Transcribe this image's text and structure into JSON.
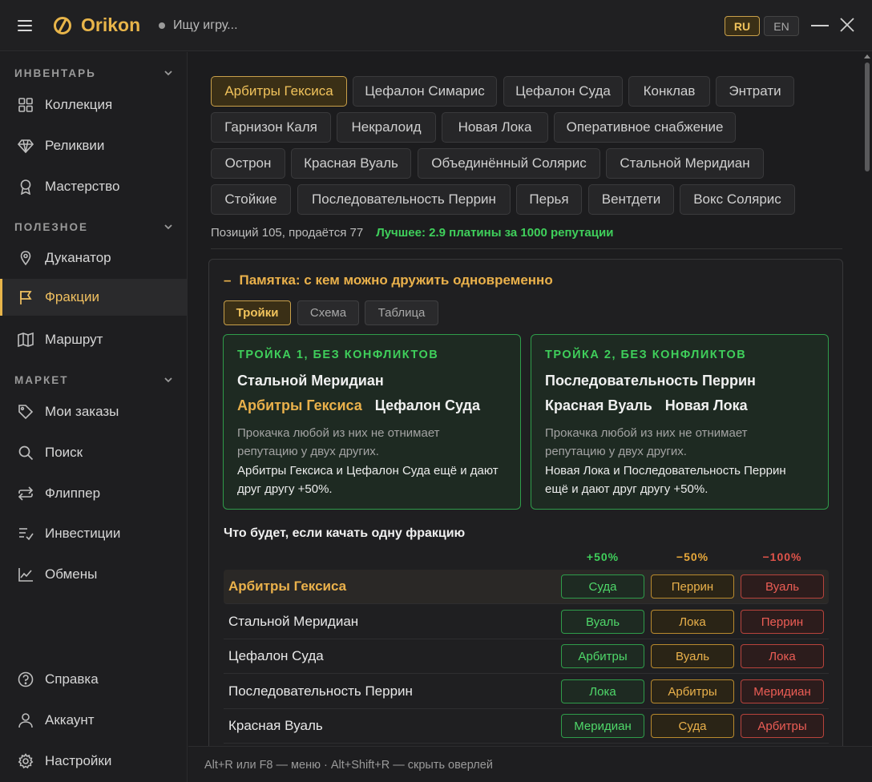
{
  "app": {
    "brand": "Orikon",
    "search_placeholder": "Ищу игру..."
  },
  "lang": {
    "ru": "RU",
    "en": "EN"
  },
  "sidebar": {
    "sections": [
      {
        "label": "ИНВЕНТАРЬ"
      },
      {
        "label": "ПОЛЕЗНОЕ"
      },
      {
        "label": "МАРКЕТ"
      }
    ],
    "items": [
      {
        "label": "Коллекция",
        "icon": "grid-icon"
      },
      {
        "label": "Реликвии",
        "icon": "diamond-icon"
      },
      {
        "label": "Мастерство",
        "icon": "medal-icon"
      },
      {
        "label": "Дуканатор",
        "icon": "pin-icon"
      },
      {
        "label": "Фракции",
        "icon": "flag-icon",
        "active": true
      },
      {
        "label": "Маршрут",
        "icon": "map-icon"
      },
      {
        "label": "Мои заказы",
        "icon": "tag-icon"
      },
      {
        "label": "Поиск",
        "icon": "search-icon"
      },
      {
        "label": "Флиппер",
        "icon": "swap-icon"
      },
      {
        "label": "Инвестиции",
        "icon": "list-check-icon"
      },
      {
        "label": "Обмены",
        "icon": "chart-icon"
      }
    ],
    "bottom": [
      {
        "label": "Справка",
        "icon": "help-icon"
      },
      {
        "label": "Аккаунт",
        "icon": "user-icon"
      },
      {
        "label": "Настройки",
        "icon": "gear-icon"
      }
    ]
  },
  "factions": [
    "Арбитры Гексиса",
    "Цефалон Симарис",
    "Цефалон Суда",
    "Конклав",
    "Энтрати",
    "Гарнизон Каля",
    "Некралоид",
    "Новая Лока",
    "Оперативное снабжение",
    "Острон",
    "Красная Вуаль",
    "Объединённый Солярис",
    "Стальной Меридиан",
    "Стойкие",
    "Последовательность Перрин",
    "Перья",
    "Вентдети",
    "Вокс Солярис"
  ],
  "stats": {
    "summary": "Позиций 105, продаётся 77",
    "best": "Лучшее: 2.9 платины за 1000 репутации"
  },
  "memo": {
    "title": "Памятка: с кем можно дружить одновременно",
    "collapse": "–",
    "tabs": [
      "Тройки",
      "Схема",
      "Таблица"
    ],
    "cards": [
      {
        "title": "ТРОЙКА 1, БЕЗ КОНФЛИКТОВ",
        "line1": "Стальной Меридиан",
        "line2a": "Арбитры Гексиса",
        "line2b": "Цефалон Суда",
        "desc": "Прокачка любой из них не отнимает репутацию у двух других.",
        "bonus": "Арбитры Гексиса и Цефалон Суда ещё и дают друг другу +50%."
      },
      {
        "title": "ТРОЙКА 2, БЕЗ КОНФЛИКТОВ",
        "line1": "Последовательность Перрин",
        "line2a": "Красная Вуаль",
        "line2b": "Новая Лока",
        "desc": "Прокачка любой из них не отнимает репутацию у двух других.",
        "bonus": "Новая Лока и Последовательность Перрин ещё и дают друг другу +50%."
      }
    ],
    "effects_title": "Что будет, если качать одну фракцию",
    "columns": [
      "+50%",
      "−50%",
      "−100%"
    ],
    "rows": [
      {
        "name": "Арбитры Гексиса",
        "plus": "Суда",
        "minus": "Перрин",
        "zero": "Вуаль"
      },
      {
        "name": "Стальной Меридиан",
        "plus": "Вуаль",
        "minus": "Лока",
        "zero": "Перрин"
      },
      {
        "name": "Цефалон Суда",
        "plus": "Арбитры",
        "minus": "Вуаль",
        "zero": "Лока"
      },
      {
        "name": "Последовательность Перрин",
        "plus": "Лока",
        "minus": "Арбитры",
        "zero": "Меридиан"
      },
      {
        "name": "Красная Вуаль",
        "plus": "Меридиан",
        "minus": "Суда",
        "zero": "Арбитры"
      }
    ]
  },
  "footer": {
    "hint": "Alt+R или F8 — меню · Alt+Shift+R — скрыть оверлей"
  }
}
